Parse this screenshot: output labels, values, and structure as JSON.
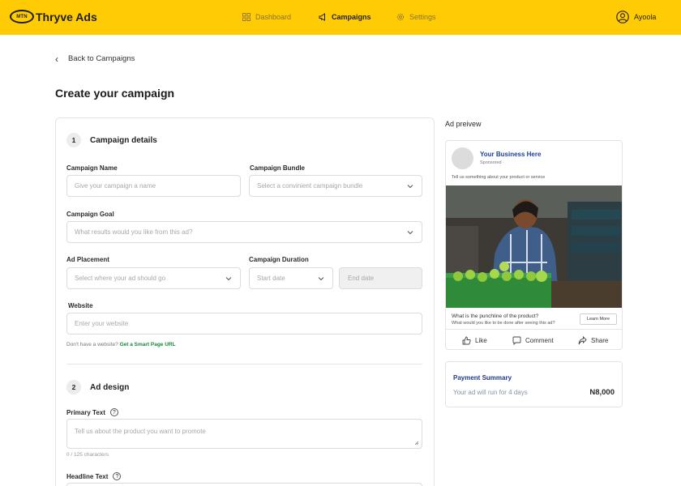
{
  "header": {
    "logo_mark": "MTN",
    "brand": "Thryve Ads",
    "nav": [
      {
        "label": "Dashboard",
        "icon": "grid-icon"
      },
      {
        "label": "Campaigns",
        "icon": "megaphone-icon"
      },
      {
        "label": "Settings",
        "icon": "gear-icon"
      }
    ],
    "active_nav": "Campaigns",
    "user": {
      "name": "Ayoola",
      "icon": "user-circle-icon"
    }
  },
  "back_link": "Back to Campaigns",
  "page_title": "Create your campaign",
  "section1": {
    "number": "1",
    "title": "Campaign details",
    "campaign_name": {
      "label": "Campaign Name",
      "placeholder": "Give your campaign a name"
    },
    "campaign_bundle": {
      "label": "Campaign Bundle",
      "placeholder": "Select a convinient campaign bundle"
    },
    "campaign_goal": {
      "label": "Campaign Goal",
      "placeholder": "What results would you like from this ad?"
    },
    "ad_placement": {
      "label": "Ad Placement",
      "placeholder": "Select where your ad should go"
    },
    "campaign_duration": {
      "label": "Campaign Duration",
      "start_placeholder": "Start date",
      "end_placeholder": "End date"
    },
    "website": {
      "label": "Website",
      "placeholder": "Enter your website"
    },
    "no_website_text": "Don't have a website?",
    "smart_page_link": "Get a Smart Page URL"
  },
  "section2": {
    "number": "2",
    "title": "Ad design",
    "primary_text": {
      "label": "Primary Text",
      "placeholder": "Tell us about the product you want to promote",
      "counter": "0 / 125 characters"
    },
    "headline_text": {
      "label": "Headline Text"
    }
  },
  "preview": {
    "label": "Ad preivew",
    "business_name": "Your Business Here",
    "sponsored": "Sponsored",
    "caption": "Tell us something about your product or service",
    "headline": "What is the punchline of the product?",
    "subline": "What would you like to be done after seeing this ad?",
    "cta": "Learn More",
    "actions": [
      {
        "label": "Like",
        "icon": "thumbs-up-icon"
      },
      {
        "label": "Comment",
        "icon": "comment-icon"
      },
      {
        "label": "Share",
        "icon": "share-icon"
      }
    ]
  },
  "payment": {
    "title": "Payment Summary",
    "duration_text": "Your ad will run for 4 days",
    "amount": "N8,000"
  },
  "colors": {
    "brand_yellow": "#ffcb05",
    "link_green": "#178a3c",
    "business_blue": "#1d3f9a"
  }
}
